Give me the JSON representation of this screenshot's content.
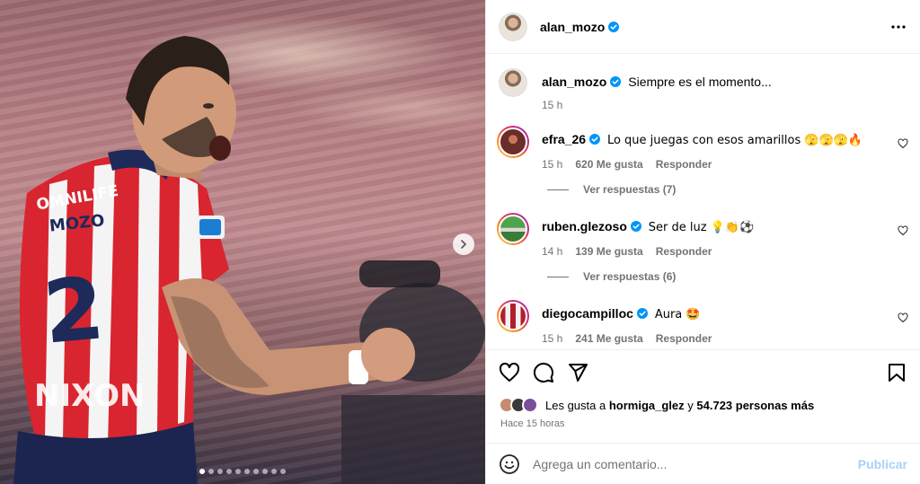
{
  "post": {
    "author": "alan_mozo",
    "caption": "Siempre es el momento...",
    "caption_time": "15 h",
    "carousel": {
      "total": 10,
      "active": 0
    }
  },
  "comments": [
    {
      "user": "efra_26",
      "text": "Lo que juegas con esos amarillos 🫣🫣🫣🔥",
      "time": "15 h",
      "likes": "620 Me gusta",
      "reply": "Responder",
      "replies": "Ver respuestas (7)"
    },
    {
      "user": "ruben.glezoso",
      "text": "Ser de luz 💡👏⚽",
      "time": "14 h",
      "likes": "139 Me gusta",
      "reply": "Responder",
      "replies": "Ver respuestas (6)"
    },
    {
      "user": "diegocampilloc",
      "text": "Aura 🤩",
      "time": "15 h",
      "likes": "241 Me gusta",
      "reply": "Responder"
    }
  ],
  "likes": {
    "prefix": "Les gusta a",
    "user": "hormiga_glez",
    "connector": "y",
    "others": "54.723 personas más"
  },
  "posted_ago": "Hace 15 horas",
  "add_comment": {
    "placeholder": "Agrega un comentario...",
    "publish": "Publicar"
  },
  "colors": {
    "verified": "#0095f6",
    "publish_disabled": "#a8d1f8",
    "meta_gray": "#737373"
  },
  "photo": {
    "jersey_sponsor": "OMNILIFE",
    "jersey_name": "MOZO",
    "jersey_number": "2",
    "jersey_front": "NIXON"
  }
}
